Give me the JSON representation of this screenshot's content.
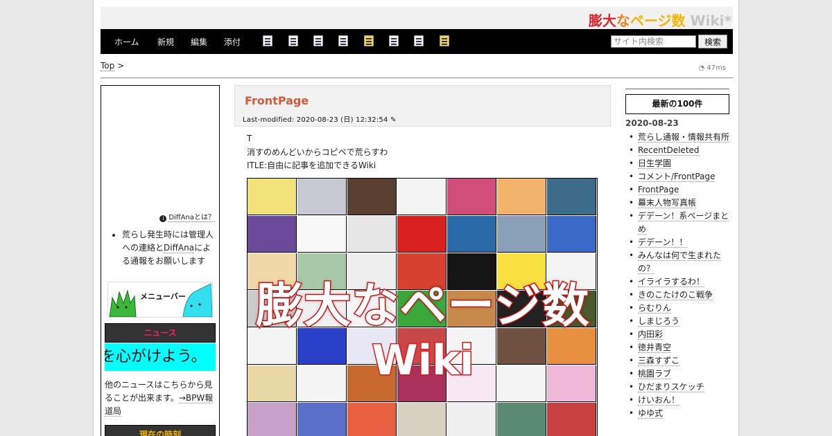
{
  "logo": {
    "part1": "膨大",
    "part2": "な",
    "part3": "ページ数",
    "part4": " Wiki*"
  },
  "nav": {
    "items": [
      "ホーム",
      "新規",
      "編集",
      "添付"
    ],
    "icons": [
      "copy-icon",
      "diff-icon",
      "backup-icon",
      "save-icon",
      "lock-icon",
      "list-icon",
      "file-icon",
      "help-icon"
    ],
    "search_placeholder": "サイト内検索",
    "search_button": "検索"
  },
  "breadcrumb": {
    "top": "Top",
    "separator": " >"
  },
  "timing": "47ms",
  "sidebar": {
    "diffana_link": "DiffAnaとは？",
    "notice_prefix": "荒らし発生時には管理人への連絡と",
    "notice_link": "DiffAna",
    "notice_suffix": "による通報をお願いします",
    "menubar_label": "メニューバー",
    "news_head": "ニュース",
    "news_text": "を心がけよう。",
    "news_more_prefix": "他のニュースはこちらから見ることが出来ます。",
    "news_more_link": "→BPW報道局",
    "time_head": "現在の時刻"
  },
  "page": {
    "title": "FrontPage",
    "last_modified": "Last-modified: 2020-08-23 (日) 12:32:54",
    "lines": [
      "T",
      "消すのめんどいからコピペで荒らすわ",
      "ITLE:自由に記事を追加できるWiki"
    ],
    "overlay_title": "膨大なページ数",
    "overlay_sub": "Wiki"
  },
  "recent": {
    "header": "最新の100件",
    "date": "2020-08-23",
    "items": [
      "荒らし通報・情報共有所",
      "RecentDeleted",
      "日生学園",
      "コメント/FrontPage",
      "FrontPage",
      "幕末人物写真帳",
      "デデーン！系ページまとめ",
      "デデーン！！",
      "みんなは何で生まれたの？",
      "イライラするわ！",
      "きのこたけのこ戦争",
      "らむりん",
      "しまじろう",
      "内田彩",
      "徳井青空",
      "三森すずこ",
      "桃園ラブ",
      "ひだまりスケッチ",
      "けいおん！",
      "ゆゆ式"
    ]
  },
  "colors": {
    "accent_red": "#e0202a",
    "title_orange": "#d65a3a",
    "news_pink": "#ff1b6b",
    "news_cyan": "#00ffff",
    "time_yellow": "#f2b400"
  }
}
